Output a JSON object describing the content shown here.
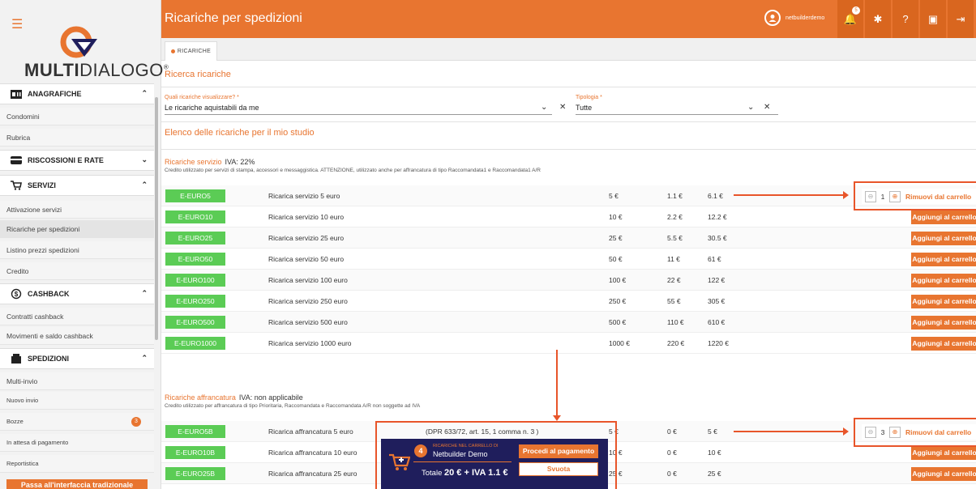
{
  "app": {
    "logo_text_bold": "MULTI",
    "logo_text_light": "DIALOGO",
    "logo_reg": "®",
    "page_title": "Ricariche per spedizioni",
    "username": "netbuilderdemo",
    "notifications": "5"
  },
  "sidebar": {
    "footer_button": "Passa all'interfaccia tradizionale",
    "sections": {
      "anagrafiche": "ANAGRAFICHE",
      "riscossioni": "RISCOSSIONI E RATE",
      "servizi": "SERVIZI",
      "cashback": "CASHBACK",
      "spedizioni": "SPEDIZIONI"
    },
    "items": {
      "condomini": "Condomini",
      "rubrica": "Rubrica",
      "attivazione": "Attivazione servizi",
      "ricariche": "Ricariche per spedizioni",
      "listino": "Listino prezzi spedizioni",
      "credito": "Credito",
      "contratti": "Contratti cashback",
      "movimenti": "Movimenti e saldo cashback",
      "multi_invio": "Multi-invio",
      "nuovo_invio": "Nuovo invio",
      "bozze": "Bozze",
      "bozze_count": "3",
      "attesa": "In attesa di pagamento",
      "reportistica": "Reportistica"
    }
  },
  "tab": {
    "label": "RICARICHE"
  },
  "search": {
    "title": "Ricerca ricariche",
    "field1_label": "Quali ricariche visualizzare? *",
    "field1_value": "Le ricariche aquistabili da me",
    "field2_label": "Tipologia *",
    "field2_value": "Tutte"
  },
  "list_title": "Elenco delle ricariche per il mio studio",
  "groups": {
    "servizio": {
      "title": "Ricariche servizio",
      "iva": "IVA: 22%",
      "desc": "Credito utilizzato per servizi di stampa, accessori e messaggistica. ATTENZIONE, utilizzato anche per affrancatura di tipo Raccomandata1 e Raccomandata1 A/R"
    },
    "affrancatura": {
      "title": "Ricariche affrancatura",
      "iva": "IVA: non applicabile",
      "desc": "Credito utilizzato per affrancatura di tipo Prioritaria, Raccomandata e Raccomandata A/R non soggette ad IVA"
    }
  },
  "rows_servizio": [
    {
      "code": "E-EURO5",
      "desc": "Ricarica servizio 5 euro",
      "price": "5 €",
      "iva": "1.1 €",
      "total": "6.1 €",
      "qty": "1"
    },
    {
      "code": "E-EURO10",
      "desc": "Ricarica servizio 10 euro",
      "price": "10 €",
      "iva": "2.2 €",
      "total": "12.2 €"
    },
    {
      "code": "E-EURO25",
      "desc": "Ricarica servizio 25 euro",
      "price": "25 €",
      "iva": "5.5 €",
      "total": "30.5 €"
    },
    {
      "code": "E-EURO50",
      "desc": "Ricarica servizio 50 euro",
      "price": "50 €",
      "iva": "11 €",
      "total": "61 €"
    },
    {
      "code": "E-EURO100",
      "desc": "Ricarica servizio 100 euro",
      "price": "100 €",
      "iva": "22 €",
      "total": "122 €"
    },
    {
      "code": "E-EURO250",
      "desc": "Ricarica servizio 250 euro",
      "price": "250 €",
      "iva": "55 €",
      "total": "305 €"
    },
    {
      "code": "E-EURO500",
      "desc": "Ricarica servizio 500 euro",
      "price": "500 €",
      "iva": "110 €",
      "total": "610 €"
    },
    {
      "code": "E-EURO1000",
      "desc": "Ricarica servizio 1000 euro",
      "price": "1000 €",
      "iva": "220 €",
      "total": "1220 €"
    }
  ],
  "rows_affr": [
    {
      "code": "E-EURO5B",
      "desc": "Ricarica affrancatura 5 euro",
      "extra": "(DPR 633/72, art. 15, 1 comma n. 3 )",
      "price": "5 €",
      "iva": "0 €",
      "total": "5 €",
      "qty": "3"
    },
    {
      "code": "E-EURO10B",
      "desc": "Ricarica affrancatura 10 euro",
      "price": "10 €",
      "iva": "0 €",
      "total": "10 €"
    },
    {
      "code": "E-EURO25B",
      "desc": "Ricarica affrancatura 25 euro",
      "price": "25 €",
      "iva": "0 €",
      "total": "25 €"
    }
  ],
  "actions": {
    "add": "Aggiungi al carrello",
    "remove": "Rimuovi dal carrello"
  },
  "cart": {
    "count": "4",
    "label": "RICARICHE NEL CARRELLO DI",
    "owner": "Netbuilder Demo",
    "total_prefix": "Totale",
    "total_value": "20 € + IVA 1.1 €",
    "pay": "Procedi al pagamento",
    "empty": "Svuota"
  },
  "colors": {
    "accent": "#e87530",
    "code_green": "#5bcc55",
    "cart_bg": "#1f1e5c",
    "annotation": "#e8552a"
  }
}
